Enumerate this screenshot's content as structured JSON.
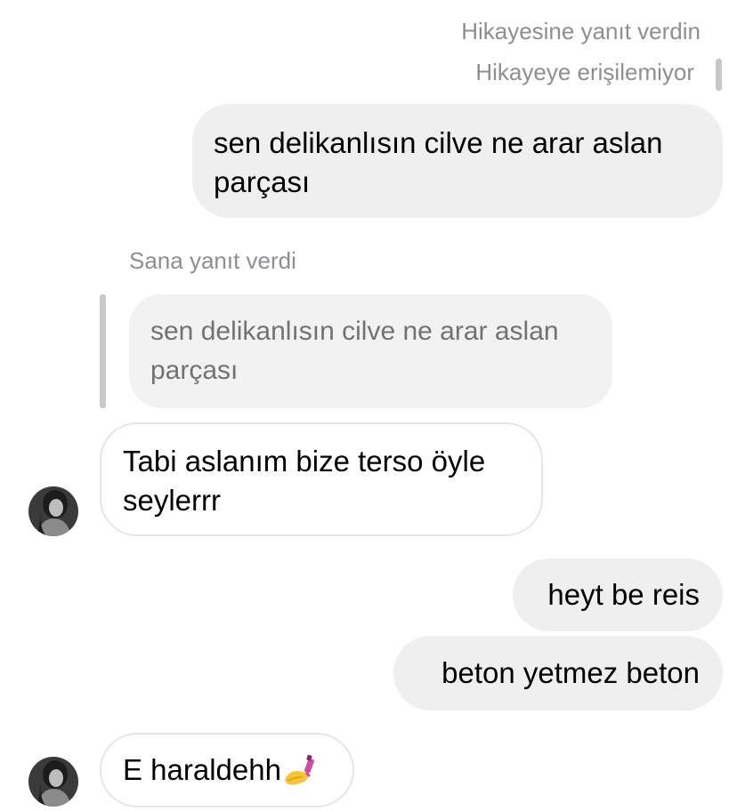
{
  "story_reply_header": {
    "replied_label": "Hikayesine yanıt verdin",
    "unavailable_label": "Hikayeye erişilemiyor"
  },
  "messages": [
    {
      "id": "m1",
      "direction": "outgoing",
      "lines": [
        "sen delikanlısın cilve ne arar aslan",
        "parçası"
      ]
    },
    {
      "id": "m2",
      "direction": "incoming",
      "reply_label": "Sana yanıt verdi",
      "quoted_lines": [
        "sen delikanlısın cilve ne arar aslan",
        "parçası"
      ],
      "lines": [
        "Tabi aslanım bize terso öyle",
        "seylerrr"
      ]
    },
    {
      "id": "m3",
      "direction": "outgoing",
      "text": "heyt be reis"
    },
    {
      "id": "m4",
      "direction": "outgoing",
      "text": "beton yetmez beton"
    },
    {
      "id": "m5",
      "direction": "incoming",
      "text": "E haraldehh",
      "emoji": "nail-polish-emoji"
    }
  ],
  "colors": {
    "outgoing_bubble": "#efefef",
    "incoming_border": "#e6e6e6",
    "meta_text": "#8e8e93",
    "quote_bar": "#c7c7cc"
  }
}
